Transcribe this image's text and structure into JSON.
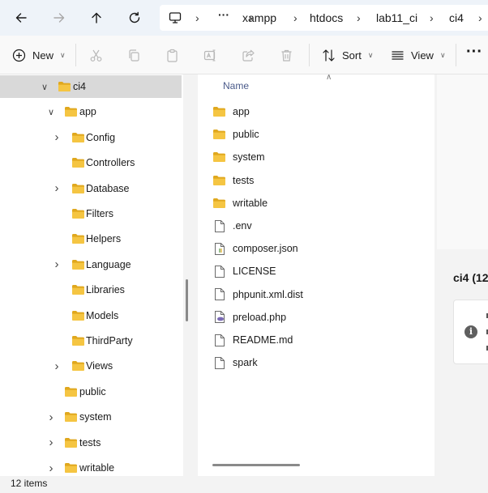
{
  "breadcrumb": {
    "overflow": "···",
    "items": [
      "xampp",
      "htdocs",
      "lab11_ci",
      "ci4"
    ]
  },
  "toolbar": {
    "new_label": "New",
    "sort_label": "Sort",
    "view_label": "View",
    "more_label": "···"
  },
  "nav_tree": [
    {
      "label": "ci4",
      "state": "expanded",
      "selected": true
    },
    {
      "label": "app",
      "state": "expanded"
    },
    {
      "label": "Config",
      "state": "collapsed"
    },
    {
      "label": "Controllers",
      "state": "none"
    },
    {
      "label": "Database",
      "state": "collapsed"
    },
    {
      "label": "Filters",
      "state": "none"
    },
    {
      "label": "Helpers",
      "state": "none"
    },
    {
      "label": "Language",
      "state": "collapsed"
    },
    {
      "label": "Libraries",
      "state": "none"
    },
    {
      "label": "Models",
      "state": "none"
    },
    {
      "label": "ThirdParty",
      "state": "none"
    },
    {
      "label": "Views",
      "state": "collapsed"
    },
    {
      "label": "public",
      "state": "none"
    },
    {
      "label": "system",
      "state": "collapsed"
    },
    {
      "label": "tests",
      "state": "collapsed"
    },
    {
      "label": "writable",
      "state": "collapsed"
    }
  ],
  "file_list": {
    "column_name": "Name",
    "items": [
      {
        "name": "app",
        "icon": "folder-icon"
      },
      {
        "name": "public",
        "icon": "folder-icon"
      },
      {
        "name": "system",
        "icon": "folder-icon"
      },
      {
        "name": "tests",
        "icon": "folder-icon"
      },
      {
        "name": "writable",
        "icon": "folder-icon"
      },
      {
        "name": ".env",
        "icon": "file-icon"
      },
      {
        "name": "composer.json",
        "icon": "json-file-icon"
      },
      {
        "name": "LICENSE",
        "icon": "file-icon"
      },
      {
        "name": "phpunit.xml.dist",
        "icon": "file-icon"
      },
      {
        "name": "preload.php",
        "icon": "php-file-icon"
      },
      {
        "name": "README.md",
        "icon": "file-icon"
      },
      {
        "name": "spark",
        "icon": "file-icon"
      }
    ]
  },
  "details": {
    "title": "ci4 (12"
  },
  "status": {
    "item_count": "12 items"
  },
  "colors": {
    "folder": "#f5c542",
    "folder_dark": "#e0a81e",
    "selection": "#d9d9d9"
  }
}
